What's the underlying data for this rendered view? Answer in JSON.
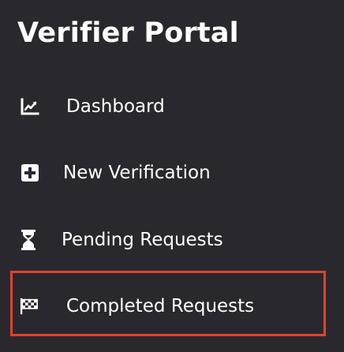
{
  "sidebar": {
    "title": "Verifier Portal",
    "items": [
      {
        "label": "Dashboard",
        "icon": "chart-line-icon"
      },
      {
        "label": "New Verification",
        "icon": "plus-square-icon"
      },
      {
        "label": "Pending Requests",
        "icon": "hourglass-icon"
      },
      {
        "label": "Completed Requests",
        "icon": "checkered-flag-icon"
      }
    ],
    "selected_index": 3
  },
  "colors": {
    "background": "#29282e",
    "text": "#ffffff",
    "highlight_border": "#e0432d"
  }
}
